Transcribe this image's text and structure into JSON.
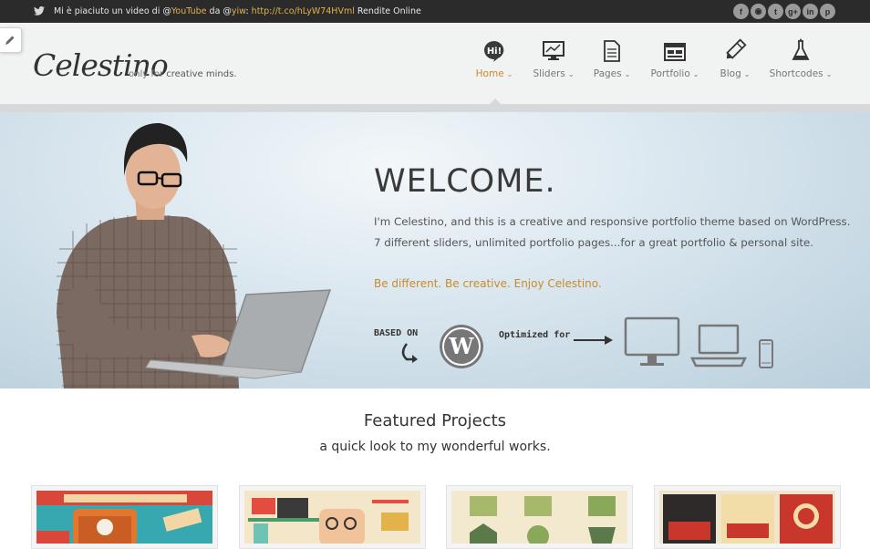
{
  "topbar": {
    "tweet_prefix": "Mi è piaciuto un video di @",
    "tweet_channel": "YouTube",
    "tweet_mid": " da @",
    "tweet_user": "yiw",
    "tweet_sep": ": ",
    "tweet_link": "http://t.co/hLyW74HVml",
    "tweet_suffix": " Rendite Online",
    "socials": [
      {
        "icon": "facebook-icon",
        "glyph": "f"
      },
      {
        "icon": "rss-icon",
        "glyph": "◉"
      },
      {
        "icon": "twitter-icon",
        "glyph": "t"
      },
      {
        "icon": "googleplus-icon",
        "glyph": "g+"
      },
      {
        "icon": "linkedin-icon",
        "glyph": "in"
      },
      {
        "icon": "pinterest-icon",
        "glyph": "p"
      }
    ]
  },
  "header": {
    "logo": "Celestino",
    "tagline_pre": "only for ",
    "tagline_bold": "creative minds."
  },
  "nav": [
    {
      "label": "Home",
      "icon": "hi-bubble-icon",
      "active": true
    },
    {
      "label": "Sliders",
      "icon": "monitor-chart-icon",
      "active": false
    },
    {
      "label": "Pages",
      "icon": "document-icon",
      "active": false
    },
    {
      "label": "Portfolio",
      "icon": "layout-icon",
      "active": false
    },
    {
      "label": "Blog",
      "icon": "pencil-icon",
      "active": false
    },
    {
      "label": "Shortcodes",
      "icon": "flask-icon",
      "active": false
    }
  ],
  "hero": {
    "title": "WELCOME.",
    "line1": "I'm Celestino, and this is a creative and responsive portfolio theme based on WordPress.",
    "line2": "7 different sliders, unlimited portfolio pages...for a great portfolio & personal site.",
    "tagline": "Be different. Be creative. Enjoy Celestino.",
    "based_on": "BASED ON",
    "optimized_for": "Optimized for"
  },
  "featured": {
    "title": "Featured Projects",
    "subtitle": "a quick look to my wonderful works."
  },
  "colors": {
    "accent": "#c98b2a",
    "topbar_bg": "#2b2b2b",
    "header_bg": "#f1f2f2"
  }
}
